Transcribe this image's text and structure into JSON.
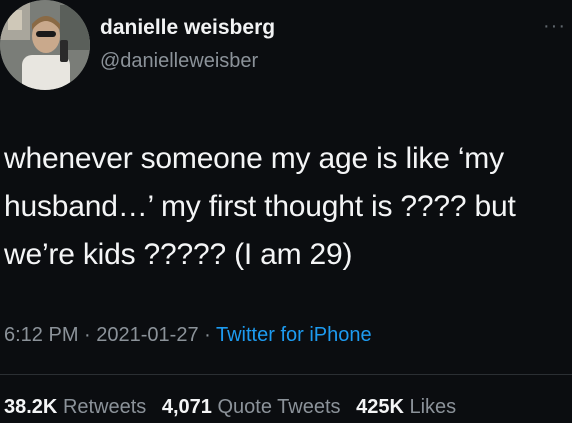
{
  "author": {
    "display_name": "danielle weisberg",
    "handle": "@danielleweisber",
    "avatar_icon": "profile-photo"
  },
  "more_icon": "ellipsis-icon",
  "more_glyph": "···",
  "tweet": {
    "text": "whenever someone my age is like ‘my\nhusband…’ my first thought is ???? but\nwe’re kids ????? (I am 29)"
  },
  "meta": {
    "time": "6:12 PM",
    "sep1": " · ",
    "date": "2021-01-27",
    "sep2": " · ",
    "source": "Twitter for iPhone"
  },
  "stats": {
    "retweets_count": "38.2K",
    "retweets_label": "Retweets",
    "quotes_count": "4,071",
    "quotes_label": "Quote Tweets",
    "likes_count": "425K",
    "likes_label": "Likes"
  },
  "colors": {
    "background": "#0b0d10",
    "link": "#1d9bf0",
    "secondary_text": "#8b9299"
  }
}
